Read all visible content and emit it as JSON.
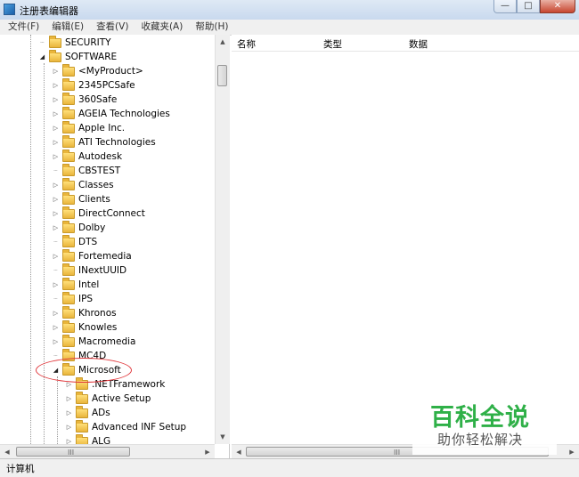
{
  "window": {
    "title": "注册表编辑器",
    "controls": {
      "minimize": "—",
      "maximize": "□",
      "close": "✕"
    }
  },
  "menu": [
    "文件(F)",
    "编辑(E)",
    "查看(V)",
    "收藏夹(A)",
    "帮助(H)"
  ],
  "tree": [
    {
      "label": "SECURITY",
      "expander": "none"
    },
    {
      "label": "SOFTWARE",
      "expander": "expanded"
    },
    {
      "label": "<MyProduct>",
      "expander": "collapsed"
    },
    {
      "label": "2345PCSafe",
      "expander": "collapsed"
    },
    {
      "label": "360Safe",
      "expander": "collapsed"
    },
    {
      "label": "AGEIA Technologies",
      "expander": "collapsed"
    },
    {
      "label": "Apple Inc.",
      "expander": "collapsed"
    },
    {
      "label": "ATI Technologies",
      "expander": "collapsed"
    },
    {
      "label": "Autodesk",
      "expander": "collapsed"
    },
    {
      "label": "CBSTEST",
      "expander": "none"
    },
    {
      "label": "Classes",
      "expander": "collapsed"
    },
    {
      "label": "Clients",
      "expander": "collapsed"
    },
    {
      "label": "DirectConnect",
      "expander": "collapsed"
    },
    {
      "label": "Dolby",
      "expander": "collapsed"
    },
    {
      "label": "DTS",
      "expander": "none"
    },
    {
      "label": "Fortemedia",
      "expander": "collapsed"
    },
    {
      "label": "INextUUID",
      "expander": "none"
    },
    {
      "label": "Intel",
      "expander": "collapsed"
    },
    {
      "label": "IPS",
      "expander": "none"
    },
    {
      "label": "Khronos",
      "expander": "collapsed"
    },
    {
      "label": "Knowles",
      "expander": "collapsed"
    },
    {
      "label": "Macromedia",
      "expander": "collapsed"
    },
    {
      "label": "MC4D",
      "expander": "none"
    },
    {
      "label": "Microsoft",
      "expander": "expanded"
    },
    {
      "label": ".NETFramework",
      "expander": "collapsed"
    },
    {
      "label": "Active Setup",
      "expander": "collapsed"
    },
    {
      "label": "ADs",
      "expander": "collapsed"
    },
    {
      "label": "Advanced INF Setup",
      "expander": "collapsed"
    },
    {
      "label": "ALG",
      "expander": "collapsed"
    }
  ],
  "list": {
    "columns": [
      "名称",
      "类型",
      "数据"
    ]
  },
  "scroll": {
    "grip": "III"
  },
  "status": "计算机",
  "watermark": {
    "main": "百科全说",
    "sub": "助你轻松解决"
  }
}
